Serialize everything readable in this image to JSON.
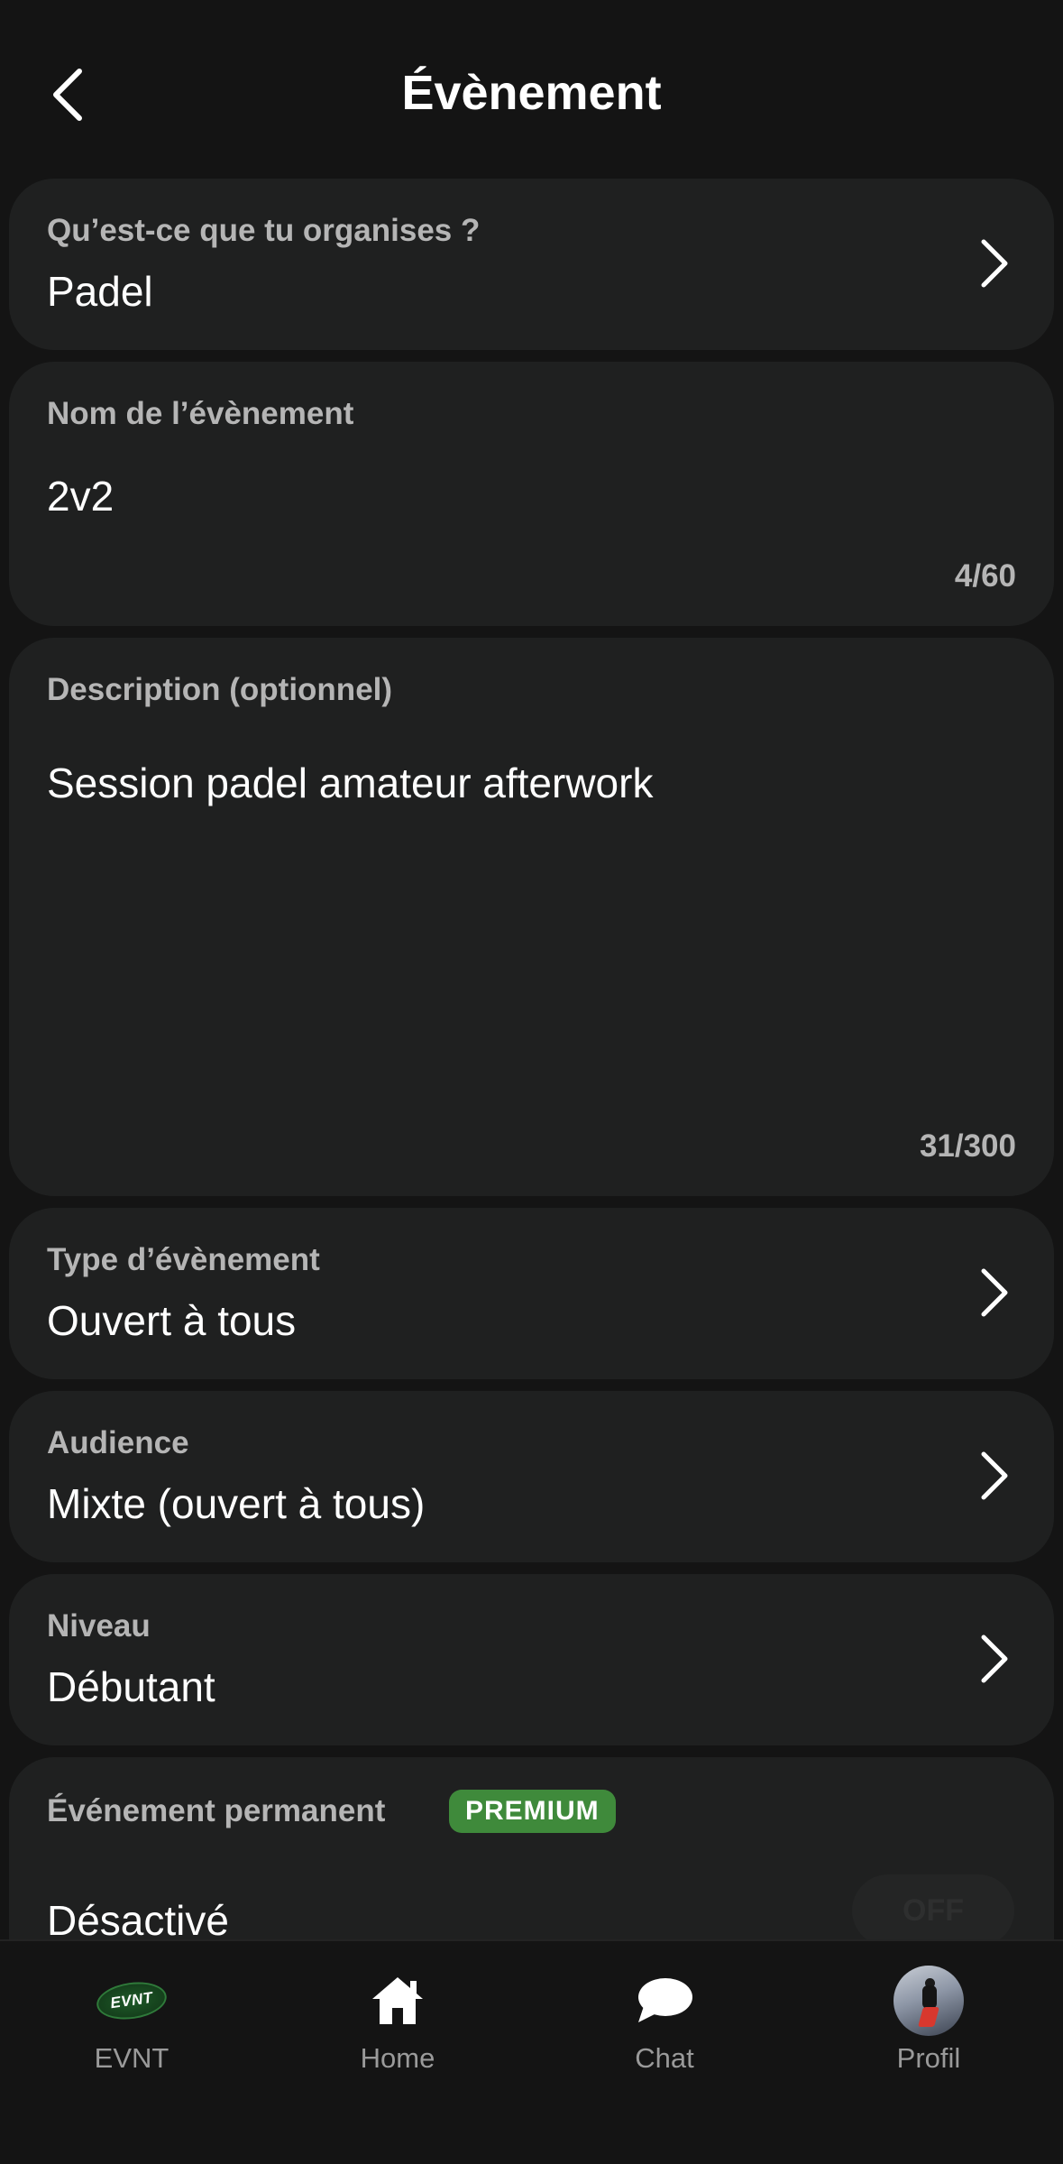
{
  "header": {
    "title": "Évènement"
  },
  "form": {
    "activity": {
      "label": "Qu’est-ce que tu organises ?",
      "value": "Padel"
    },
    "name": {
      "label": "Nom de l’évènement",
      "value": "2v2",
      "counter": "4/60"
    },
    "description": {
      "label": "Description (optionnel)",
      "value": "Session padel amateur afterwork",
      "counter": "31/300"
    },
    "event_type": {
      "label": "Type d’évènement",
      "value": "Ouvert à tous"
    },
    "audience": {
      "label": "Audience",
      "value": "Mixte (ouvert à tous)"
    },
    "level": {
      "label": "Niveau",
      "value": "Débutant"
    },
    "permanent": {
      "label": "Événement permanent",
      "badge": "PREMIUM",
      "value": "Désactivé",
      "toggle_text": "OFF"
    }
  },
  "tabbar": {
    "items": [
      {
        "label": "EVNT",
        "logo_text": "EVNT",
        "icon": "evnt-logo"
      },
      {
        "label": "Home",
        "icon": "home-icon"
      },
      {
        "label": "Chat",
        "icon": "chat-bubble-icon"
      },
      {
        "label": "Profil",
        "icon": "avatar"
      }
    ]
  },
  "colors": {
    "background": "#141414",
    "card": "#1f2020",
    "label": "#b5b5b5",
    "premium_badge": "#3f8a3b"
  }
}
